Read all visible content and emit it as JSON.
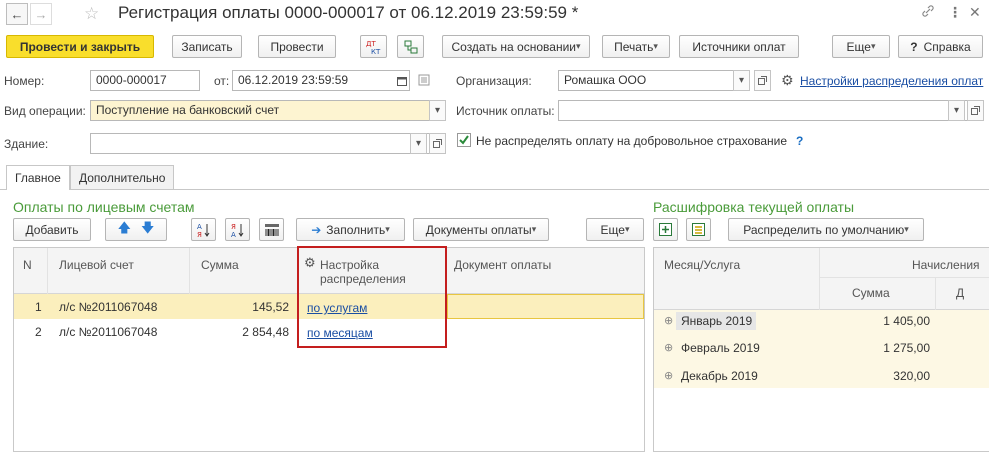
{
  "window": {
    "title": "Регистрация оплаты 0000-000017 от 06.12.2019 23:59:59 *",
    "back_icon": "arrow-left-icon",
    "forward_icon": "arrow-right-icon",
    "star_icon": "star-icon",
    "link_icon": "link-icon",
    "more_icon": "vertical-dots-icon",
    "close_icon": "close-icon"
  },
  "toolbar": {
    "post_and_close": "Провести и закрыть",
    "save": "Записать",
    "post": "Провести",
    "dt_kt_top": "ДТ",
    "dt_kt_bottom": "КТ",
    "create_based_on": "Создать на основании",
    "print": "Печать",
    "payment_sources": "Источники оплат",
    "more": "Еще",
    "help_q": "?",
    "help": "Справка"
  },
  "form": {
    "number_label": "Номер:",
    "number_value": "0000-000017",
    "date_label": "от:",
    "date_value": "06.12.2019 23:59:59",
    "org_label": "Организация:",
    "org_value": "Ромашка ООО",
    "distribution_settings_link": "Настройки распределения оплат",
    "operation_type_label": "Вид операции:",
    "operation_type_value": "Поступление на банковский счет",
    "payment_source_label": "Источник оплаты:",
    "payment_source_value": "",
    "building_label": "Здание:",
    "building_value": "",
    "no_distribute_insurance": "Не распределять оплату на добровольное страхование",
    "no_distribute_checked": true,
    "help_q": "?"
  },
  "tabs": [
    {
      "label": "Главное",
      "active": true
    },
    {
      "label": "Дополнительно",
      "active": false
    }
  ],
  "left_panel": {
    "title": "Оплаты по лицевым счетам",
    "add_button": "Добавить",
    "fill_button": "Заполнить",
    "payment_docs_button": "Документы оплаты",
    "more_button": "Еще",
    "columns": {
      "n": "N",
      "account": "Лицевой счет",
      "sum": "Сумма",
      "distribution_line1": "Настройка",
      "distribution_line2": "распределения",
      "payment_doc": "Документ оплаты"
    },
    "rows": [
      {
        "n": "1",
        "account": "л/с №2011067048",
        "sum": "145,52",
        "distribution": "по услугам",
        "doc": ""
      },
      {
        "n": "2",
        "account": "л/с №2011067048",
        "sum": "2 854,48",
        "distribution": "по месяцам",
        "doc": ""
      }
    ]
  },
  "right_panel": {
    "title": "Расшифровка текущей оплаты",
    "distribute_default_button": "Распределить по умолчанию",
    "columns": {
      "month_service": "Месяц/Услуга",
      "accruals": "Начисления",
      "sum": "Сумма",
      "cut_col": "Д"
    },
    "rows": [
      {
        "label": "Январь 2019",
        "sum": "1 405,00"
      },
      {
        "label": "Февраль 2019",
        "sum": "1 275,00"
      },
      {
        "label": "Декабрь 2019",
        "sum": "320,00"
      }
    ]
  },
  "colors": {
    "accent_yellow": "#f9de2c",
    "section_green": "#4a9b3a",
    "selected_row": "#fbefbd",
    "highlight_red": "#c41e1e",
    "link_blue": "#1a4ea3"
  }
}
